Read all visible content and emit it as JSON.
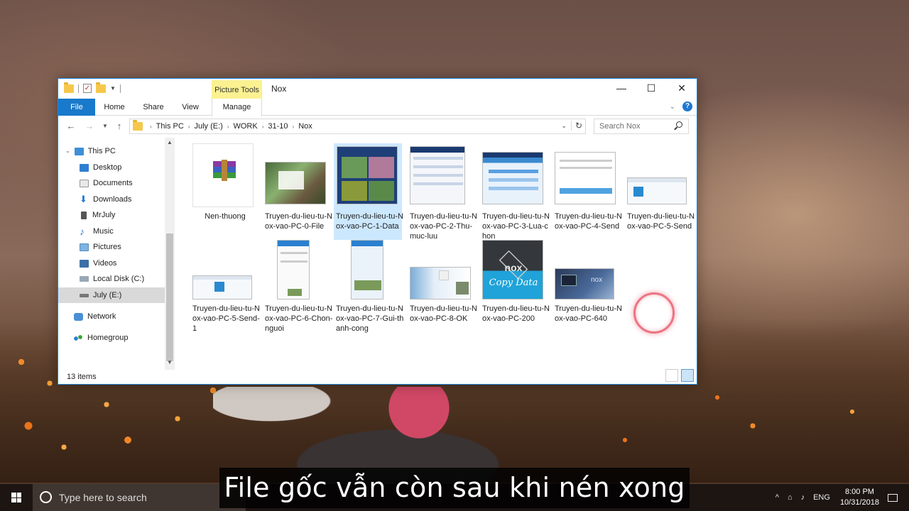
{
  "window": {
    "title": "Nox",
    "contextual_tab_group": "Picture Tools",
    "controls": {
      "minimize": "—",
      "maximize": "☐",
      "close": "✕"
    }
  },
  "ribbon": {
    "tabs": [
      "File",
      "Home",
      "Share",
      "View",
      "Manage"
    ]
  },
  "address": {
    "segments": [
      "This PC",
      "July (E:)",
      "WORK",
      "31-10",
      "Nox"
    ]
  },
  "search": {
    "placeholder": "Search Nox"
  },
  "nav": {
    "items": [
      {
        "label": "This PC",
        "icon": "monitor-icon"
      },
      {
        "label": "Desktop",
        "icon": "desktop-icon"
      },
      {
        "label": "Documents",
        "icon": "documents-icon"
      },
      {
        "label": "Downloads",
        "icon": "download-arrow-icon"
      },
      {
        "label": "MrJuly",
        "icon": "user-folder-icon"
      },
      {
        "label": "Music",
        "icon": "music-note-icon"
      },
      {
        "label": "Pictures",
        "icon": "pictures-icon"
      },
      {
        "label": "Videos",
        "icon": "videos-icon"
      },
      {
        "label": "Local Disk (C:)",
        "icon": "drive-icon"
      },
      {
        "label": "July (E:)",
        "icon": "drive-icon"
      },
      {
        "label": "Network",
        "icon": "network-icon"
      },
      {
        "label": "Homegroup",
        "icon": "homegroup-icon"
      }
    ],
    "selected": "July (E:)"
  },
  "files": [
    {
      "name": "Nen-thuong",
      "kind": "winrar-archive-icon"
    },
    {
      "name": "Truyen-du-lieu-tu-Nox-vao-PC-0-File",
      "kind": "image"
    },
    {
      "name": "Truyen-du-lieu-tu-Nox-vao-PC-1-Data",
      "kind": "image",
      "selected": true
    },
    {
      "name": "Truyen-du-lieu-tu-Nox-vao-PC-2-Thu-muc-luu",
      "kind": "image"
    },
    {
      "name": "Truyen-du-lieu-tu-Nox-vao-PC-3-Lua-chon",
      "kind": "image"
    },
    {
      "name": "Truyen-du-lieu-tu-Nox-vao-PC-4-Send",
      "kind": "image"
    },
    {
      "name": "Truyen-du-lieu-tu-Nox-vao-PC-5-Send",
      "kind": "image"
    },
    {
      "name": "Truyen-du-lieu-tu-Nox-vao-PC-5-Send-1",
      "kind": "image"
    },
    {
      "name": "Truyen-du-lieu-tu-Nox-vao-PC-6-Chon-nguoi",
      "kind": "image"
    },
    {
      "name": "Truyen-du-lieu-tu-Nox-vao-PC-7-Gui-thanh-cong",
      "kind": "image"
    },
    {
      "name": "Truyen-du-lieu-tu-Nox-vao-PC-8-OK",
      "kind": "image"
    },
    {
      "name": "Truyen-du-lieu-tu-Nox-vao-PC-200",
      "kind": "image"
    },
    {
      "name": "Truyen-du-lieu-tu-Nox-vao-PC-640",
      "kind": "image"
    }
  ],
  "thumb_text": {
    "nox_logo": "nox",
    "copy_data": "Copy Data"
  },
  "status": {
    "items_count": "13 items"
  },
  "taskbar": {
    "search_placeholder": "Type here to search",
    "language": "ENG",
    "time": "8:00 PM",
    "date": "10/31/2018"
  },
  "subtitle": "File gốc vẫn còn sau khi nén xong",
  "colors": {
    "accent": "#1979ca",
    "picture_tools": "#fbf191",
    "selection": "#cce8ff"
  }
}
